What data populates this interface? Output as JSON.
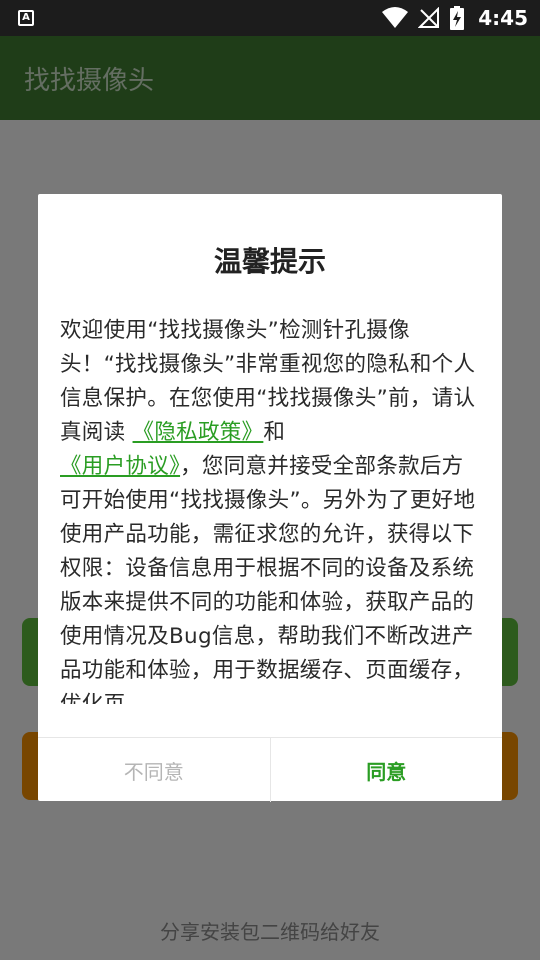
{
  "status_bar": {
    "app_badge": "A",
    "time": "4:45"
  },
  "app_bar": {
    "title": "找找摄像头"
  },
  "background": {
    "share_link": "分享安装包二维码给好友"
  },
  "dialog": {
    "title": "温馨提示",
    "body_part1": "欢迎使用“找找摄像头”检测针孔摄像头！“找找摄像头”非常重视您的隐私和个人信息保护。在您使用“找找摄像头”前，请认真阅读 ",
    "privacy_link": "《隐私政策》",
    "body_and": "和",
    "user_agreement_link": "《用户协议》",
    "body_part2": "，您同意并接受全部条款后方可开始使用“找找摄像头”。另外为了更好地使用产品功能，需征求您的允许，获得以下权限：设备信息用于根据不同的设备及系统版本来提供不同的功能和体验，获取产品的使用情况及Bug信息，帮助我们不断改进产品功能和体验，用于数据缓存、页面缓存，优化页",
    "disagree_label": "不同意",
    "agree_label": "同意"
  },
  "colors": {
    "app_bar": "#3e7a30",
    "link": "#2a9d23",
    "bg_button_green": "#5bb63a",
    "bg_button_orange": "#f08c00"
  }
}
